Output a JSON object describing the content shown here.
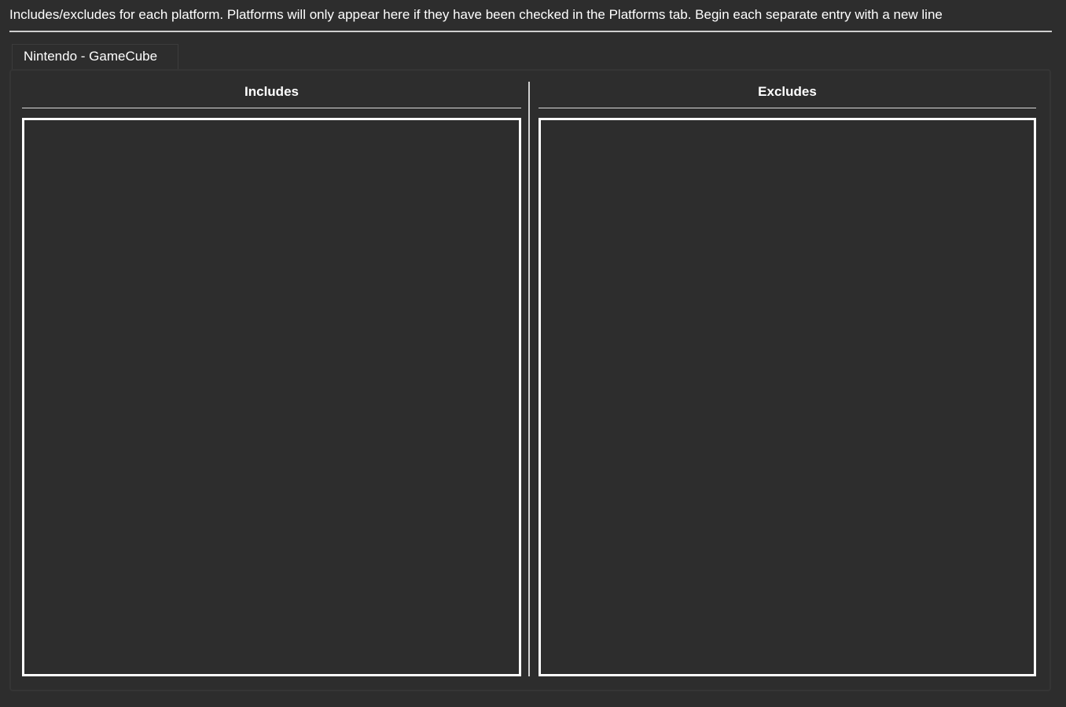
{
  "description": "Includes/excludes for each platform. Platforms will only appear here if they have been checked in the Platforms tab. Begin each separate entry with a new line",
  "tabs": [
    {
      "label": "Nintendo - GameCube",
      "selected": true
    }
  ],
  "columns": {
    "includes": {
      "header": "Includes",
      "value": ""
    },
    "excludes": {
      "header": "Excludes",
      "value": ""
    }
  },
  "colors": {
    "background": "#2d2d2d",
    "text": "#ffffff",
    "border": "#ffffff"
  }
}
